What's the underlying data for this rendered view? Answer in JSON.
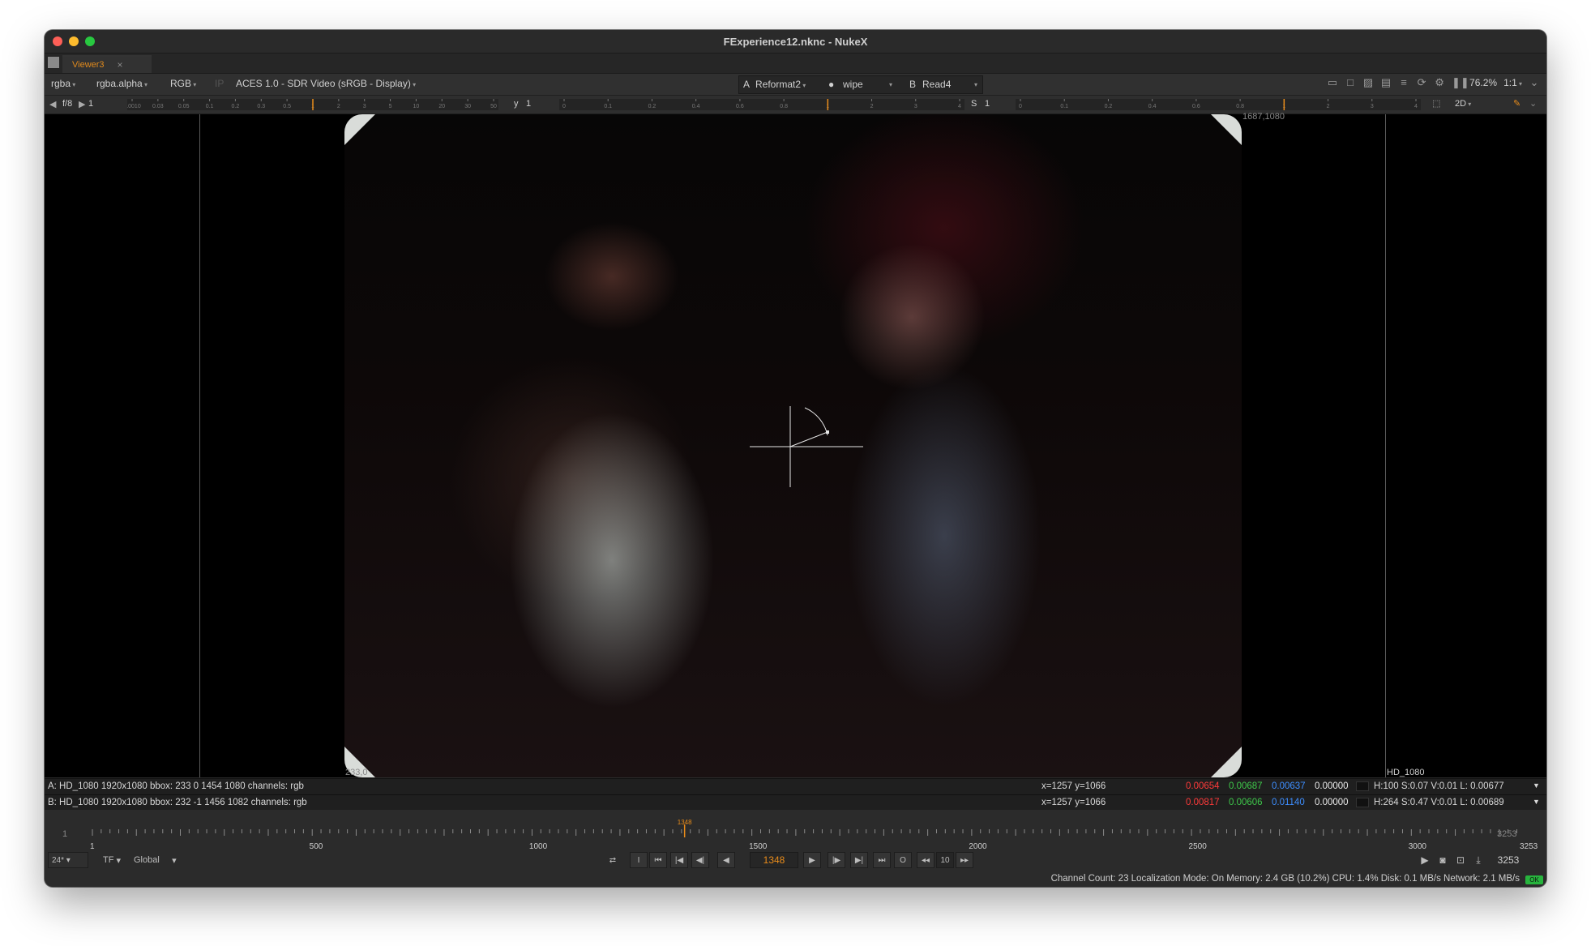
{
  "window": {
    "title": "FExperience12.nknc - NukeX"
  },
  "tab": {
    "label": "Viewer3",
    "close": "×"
  },
  "toolbar": {
    "channels": "rgba",
    "alpha": "rgba.alpha",
    "colorspace": "RGB",
    "ip": "IP",
    "display": "ACES 1.0 - SDR Video (sRGB - Display)",
    "input_a_letter": "A",
    "input_a": "Reformat2",
    "wipe": "wipe",
    "input_b_letter": "B",
    "input_b": "Read4",
    "zoom": "76.2%",
    "ratio": "1:1"
  },
  "toolbar2": {
    "fstop": "f/8",
    "fstop_value": "1",
    "gamma_label": "y",
    "gamma_value": "1",
    "sat_label": "S",
    "sat_value": "1",
    "view_mode": "2D",
    "fstop_ticks": [
      "0.0010",
      "0.03",
      "0.05",
      "0.1",
      "0.2",
      "0.3",
      "0.5",
      "1",
      "2",
      "3",
      "5",
      "10",
      "20",
      "30",
      "50"
    ],
    "gamma_ticks": [
      "0",
      "0.1",
      "0.2",
      "0.4",
      "0.6",
      "0.8",
      "1",
      "2",
      "3",
      "4"
    ],
    "sat_ticks": [
      "0",
      "0.1",
      "0.2",
      "0.4",
      "0.6",
      "0.8",
      "1",
      "2",
      "3",
      "4"
    ]
  },
  "viewer": {
    "bbox_top_right": "1687,1080",
    "bbox_bottom_left": "233,0",
    "format_label": "HD_1080"
  },
  "info": {
    "a": {
      "desc": "A:  HD_1080 1920x1080  bbox: 233 0 1454 1080 channels: rgb",
      "coords": "x=1257 y=1066",
      "r": "0.00654",
      "g": "0.00687",
      "b": "0.00637",
      "a": "0.00000",
      "hsv": "H:100 S:0.07 V:0.01  L: 0.00677"
    },
    "b": {
      "desc": "B:  HD_1080 1920x1080  bbox: 232 -1 1456 1082 channels: rgb",
      "coords": "x=1257 y=1066",
      "r": "0.00817",
      "g": "0.00606",
      "b": "0.01140",
      "a": "0.00000",
      "hsv": "H:264 S:0.47 V:0.01  L: 0.00689"
    }
  },
  "timeline": {
    "start": "1",
    "end": "3253",
    "current": "1348",
    "labels": [
      "1",
      "500",
      "1000",
      "1500",
      "2000",
      "2500",
      "3000",
      "3253"
    ],
    "label_values": [
      1,
      500,
      1000,
      1500,
      2000,
      2500,
      3000,
      3253
    ],
    "range_max": 3253,
    "fps": "24*",
    "tf": "TF",
    "global": "Global",
    "skip": "10",
    "in": "I",
    "out": "O"
  },
  "status": {
    "text": "Channel Count: 23  Localization Mode: On  Memory: 2.4 GB (10.2%)  CPU: 1.4%  Disk: 0.1 MB/s  Network: 2.1 MB/s",
    "badge": "OK"
  },
  "colors": {
    "accent": "#e98c1a",
    "red_value": "#ff3a3a",
    "green_value": "#3ec74a",
    "blue_value": "#3d8eff"
  }
}
